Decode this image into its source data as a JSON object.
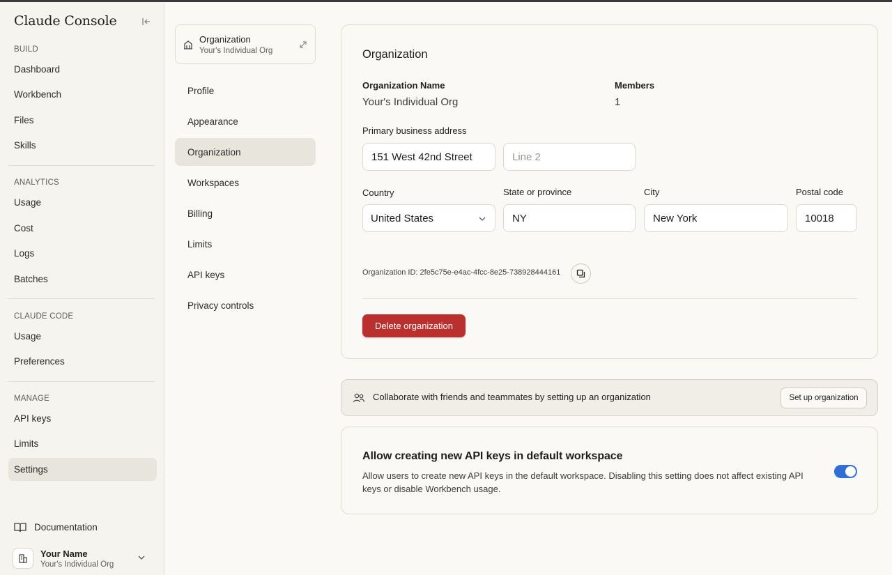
{
  "sidebar": {
    "brand": "Claude Console",
    "sections": {
      "build": "BUILD",
      "analytics": "ANALYTICS",
      "claude_code": "CLAUDE CODE",
      "manage": "MANAGE"
    },
    "items": {
      "dashboard": "Dashboard",
      "workbench": "Workbench",
      "files": "Files",
      "skills": "Skills",
      "usage": "Usage",
      "cost": "Cost",
      "logs": "Logs",
      "batches": "Batches",
      "cc_usage": "Usage",
      "preferences": "Preferences",
      "api_keys": "API keys",
      "limits": "Limits",
      "settings": "Settings"
    },
    "active_item": "Settings",
    "documentation": "Documentation",
    "user": {
      "name": "Your Name",
      "org": "Your's Individual Org"
    }
  },
  "settings_nav": {
    "org_switcher": {
      "title": "Organization",
      "subtitle": "Your's Individual Org"
    },
    "items": {
      "profile": "Profile",
      "appearance": "Appearance",
      "organization": "Organization",
      "workspaces": "Workspaces",
      "billing": "Billing",
      "limits": "Limits",
      "api_keys": "API keys",
      "privacy": "Privacy controls"
    },
    "active_item": "Organization"
  },
  "org_card": {
    "title": "Organization",
    "org_name_label": "Organization Name",
    "org_name_value": "Your's Individual Org",
    "members_label": "Members",
    "members_value": "1",
    "address_label": "Primary business address",
    "address_line1": "151 West 42nd Street",
    "address_line2_placeholder": "Line 2",
    "country_label": "Country",
    "country_value": "United States",
    "state_label": "State or province",
    "state_value": "NY",
    "city_label": "City",
    "city_value": "New York",
    "postal_label": "Postal code",
    "postal_value": "10018",
    "org_id_text": "Organization ID: 2fe5c75e-e4ac-4fcc-8e25-738928444161",
    "delete_label": "Delete organization"
  },
  "banner": {
    "text": "Collaborate with friends and teammates by setting up an organization",
    "button": "Set up organization"
  },
  "api_card": {
    "title": "Allow creating new API keys in default workspace",
    "description": "Allow users to create new API keys in the default workspace. Disabling this setting does not affect existing API keys or disable Workbench usage.",
    "toggle_on": true
  },
  "colors": {
    "background": "#faf9f5",
    "sidebar": "#f5f4ef",
    "active_item": "#e8e5dc",
    "danger": "#b9302f",
    "toggle_accent": "#2f6fd6"
  }
}
